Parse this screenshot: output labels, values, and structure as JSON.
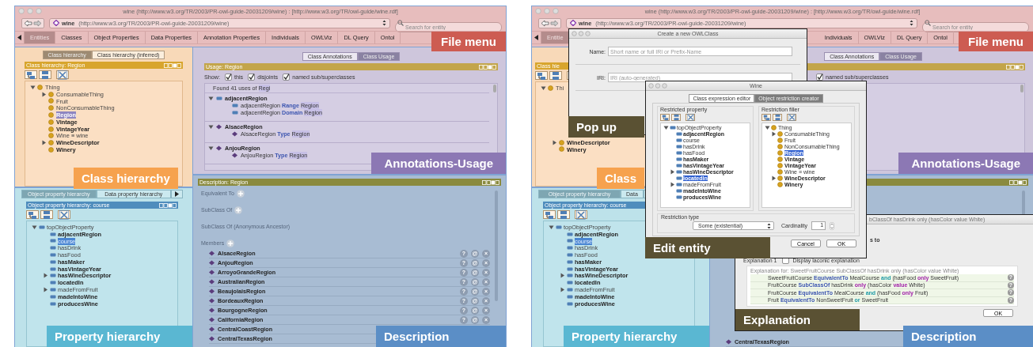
{
  "figures": [
    {
      "window": {
        "title": "wine (http://www.w3.org/TR/2003/PR-owl-guide-20031209/wine)  : [http://www.w3.org/TR/owl-guide/wine.rdf]"
      },
      "address": {
        "name": "wine",
        "iri": "(http://www.w3.org/TR/2003/PR-owl-guide-20031209/wine)"
      },
      "search": {
        "placeholder": "Search for entity"
      },
      "tabs": [
        {
          "label": "Entities",
          "selected": true
        },
        {
          "label": "Classes",
          "selected": false
        },
        {
          "label": "Object Properties",
          "selected": false
        },
        {
          "label": "Data Properties",
          "selected": false
        },
        {
          "label": "Annotation Properties",
          "selected": false
        },
        {
          "label": "Individuals",
          "selected": false
        },
        {
          "label": "OWLViz",
          "selected": false
        },
        {
          "label": "DL Query",
          "selected": false
        },
        {
          "label": "Ontol",
          "selected": false
        }
      ],
      "class_pane": {
        "tabs": [
          {
            "label": "Class hierarchy",
            "selected": true
          },
          {
            "label": "Class hierarchy (inferred)",
            "selected": false
          }
        ],
        "title": "Class hierarchy: Region",
        "tree": [
          {
            "label": "Thing",
            "kind": "class",
            "expanded": true,
            "bold": false,
            "selected": false,
            "children": [
              {
                "label": "ConsumableThing",
                "kind": "class",
                "expanded": false,
                "bold": false,
                "selected": false
              },
              {
                "label": "Fruit",
                "kind": "class",
                "bold": false,
                "selected": false
              },
              {
                "label": "NonConsumableThing",
                "kind": "class",
                "bold": false,
                "selected": false
              },
              {
                "label": "Region",
                "kind": "class",
                "bold": true,
                "selected": true
              },
              {
                "label": "Vintage",
                "kind": "class",
                "bold": true,
                "selected": false
              },
              {
                "label": "VintageYear",
                "kind": "class",
                "bold": true,
                "selected": false
              },
              {
                "label": "Wine ≡ wine",
                "kind": "class",
                "bold": false,
                "selected": false
              },
              {
                "label": "WineDescriptor",
                "kind": "class",
                "expanded": false,
                "bold": true,
                "selected": false
              },
              {
                "label": "Winery",
                "kind": "class",
                "bold": true,
                "selected": false
              }
            ]
          }
        ]
      },
      "usage_pane": {
        "tabs": [
          {
            "label": "Class Annotations",
            "selected": false
          },
          {
            "label": "Class Usage",
            "selected": true
          }
        ],
        "title": "Usage: Region",
        "show_label": "Show:",
        "options": [
          {
            "label": "this",
            "checked": true
          },
          {
            "label": "disjoints",
            "checked": true
          },
          {
            "label": "named sub/superclasses",
            "checked": true
          }
        ],
        "found": [
          {
            "text": "Found 41 uses of",
            "kind": "name"
          },
          {
            "text": "Regi",
            "kind": "match"
          }
        ],
        "groups": [
          {
            "kind": "property",
            "name": "adjacentRegion",
            "expanded": true,
            "axioms": [
              {
                "kind": "property",
                "tokens": [
                  {
                    "text": "adjacentRegion",
                    "kind": "name"
                  },
                  {
                    "text": "Range",
                    "kind": "keyword"
                  },
                  {
                    "text": "Region",
                    "kind": "match"
                  }
                ]
              },
              {
                "kind": "property",
                "tokens": [
                  {
                    "text": "adjacentRegion",
                    "kind": "name"
                  },
                  {
                    "text": "Domain",
                    "kind": "keyword"
                  },
                  {
                    "text": "Region",
                    "kind": "match"
                  }
                ]
              }
            ]
          },
          {
            "kind": "individual",
            "name": "AlsaceRegion",
            "expanded": true,
            "axioms": [
              {
                "kind": "individual",
                "tokens": [
                  {
                    "text": "AlsaceRegion",
                    "kind": "name"
                  },
                  {
                    "text": "Type",
                    "kind": "keyword"
                  },
                  {
                    "text": "Region",
                    "kind": "match"
                  }
                ]
              }
            ]
          },
          {
            "kind": "individual",
            "name": "AnjouRegion",
            "expanded": true,
            "axioms": [
              {
                "kind": "individual",
                "tokens": [
                  {
                    "text": "AnjouRegion",
                    "kind": "name"
                  },
                  {
                    "text": "Type",
                    "kind": "keyword"
                  },
                  {
                    "text": "Region",
                    "kind": "match"
                  }
                ]
              }
            ]
          }
        ]
      },
      "property_pane": {
        "tabs": [
          {
            "label": "Object property hierarchy",
            "selected": true
          },
          {
            "label": "Data property hierarchy",
            "selected": false
          }
        ],
        "title": "Object property hierarchy: course",
        "tree": [
          {
            "label": "topObjectProperty",
            "kind": "property",
            "expanded": true,
            "bold": false,
            "selected": false,
            "children": [
              {
                "label": "adjacentRegion",
                "kind": "property",
                "bold": true,
                "selected": false
              },
              {
                "label": "course",
                "kind": "property",
                "bold": false,
                "selected": true
              },
              {
                "label": "hasDrink",
                "kind": "property",
                "bold": false,
                "selected": false
              },
              {
                "label": "hasFood",
                "kind": "property",
                "bold": false,
                "selected": false
              },
              {
                "label": "hasMaker",
                "kind": "property",
                "bold": true,
                "selected": false
              },
              {
                "label": "hasVintageYear",
                "kind": "property",
                "bold": true,
                "selected": false
              },
              {
                "label": "hasWineDescriptor",
                "kind": "property",
                "expanded": false,
                "bold": true,
                "selected": false
              },
              {
                "label": "locatedIn",
                "kind": "property",
                "bold": true,
                "selected": false
              },
              {
                "label": "madeFromFruit",
                "kind": "property",
                "expanded": false,
                "bold": false,
                "selected": false
              },
              {
                "label": "madeIntoWine",
                "kind": "property",
                "bold": true,
                "selected": false
              },
              {
                "label": "producesWine",
                "kind": "property",
                "bold": true,
                "selected": false
              }
            ]
          }
        ]
      },
      "description_pane": {
        "title": "Description: Region",
        "sections": [
          {
            "label": "Equivalent To",
            "addable": true
          },
          {
            "label": "SubClass Of",
            "addable": true
          },
          {
            "label": "SubClass Of (Anonymous Ancestor)",
            "addable": false
          },
          {
            "label": "Members",
            "addable": true
          }
        ],
        "members": [
          {
            "name": "AlsaceRegion",
            "buttons": [
              "?",
              "@",
              "×"
            ]
          },
          {
            "name": "AnjouRegion",
            "buttons": [
              "?",
              "@",
              "×"
            ]
          },
          {
            "name": "ArroyoGrandeRegion",
            "buttons": [
              "?",
              "@",
              "×"
            ]
          },
          {
            "name": "AustralianRegion",
            "buttons": [
              "?",
              "@",
              "×"
            ]
          },
          {
            "name": "BeaujolaisRegion",
            "buttons": [
              "?",
              "@",
              "×"
            ]
          },
          {
            "name": "BordeauxRegion",
            "buttons": [
              "?",
              "@",
              "×"
            ]
          },
          {
            "name": "BourgogneRegion",
            "buttons": [
              "?",
              "@",
              "×"
            ]
          },
          {
            "name": "CaliforniaRegion",
            "buttons": [
              "?",
              "@",
              "×"
            ]
          },
          {
            "name": "CentralCoastRegion"
          },
          {
            "name": "CentralTexasRegion"
          }
        ]
      },
      "callouts": [
        {
          "kind": "tabs",
          "text": "File menu",
          "color": "#cd5c52"
        },
        {
          "kind": "class-pane",
          "text": "Class hierarchy",
          "color": "#f6a24e"
        },
        {
          "kind": "usage-pane",
          "text": "Annotations-Usage",
          "color": "#8c78b4"
        },
        {
          "kind": "property-pane",
          "text": "Property hierarchy",
          "color": "#5ab7d2"
        },
        {
          "kind": "description-pane",
          "text": "Description",
          "color": "#5b8ec6"
        }
      ]
    },
    {
      "window": {
        "title": "wine (http://www.w3.org/TR/2003/PR-owl-guide-20031209/wine)  : [http://www.w3.org/TR/owl-guide/wine.rdf]"
      },
      "address": {
        "name": "wine",
        "iri": "(http://www.w3.org/TR/2003/PR-owl-guide-20031209/wine)"
      },
      "search": {
        "placeholder": "Search for entity"
      },
      "tabs": [
        {
          "label": "Entitie",
          "selected": true
        },
        {
          "label": "Individuals",
          "selected": false
        },
        {
          "label": "OWLViz",
          "selected": false
        },
        {
          "label": "DL Query",
          "selected": false
        },
        {
          "label": "Ontol",
          "selected": false
        }
      ],
      "class_pane": {
        "title": "Class hie",
        "tree": [
          {
            "label": "Thi",
            "kind": "class",
            "expanded": true,
            "bold": false,
            "selected": false,
            "children": [
              {
                "label": "WineDescriptor",
                "kind": "class",
                "expanded": false,
                "bold": true,
                "selected": false
              },
              {
                "label": "Winery",
                "kind": "class",
                "bold": true,
                "selected": false
              }
            ]
          }
        ]
      },
      "usage_pane": {
        "tabs": [
          {
            "label": "Class Annotations",
            "selected": false
          },
          {
            "label": "Class Usage",
            "selected": true
          }
        ],
        "options": [
          {
            "label": "named sub/superclasses",
            "checked": true
          }
        ]
      },
      "property_pane": {
        "tabs": [
          {
            "label": "Object property hierarchy",
            "selected": true
          },
          {
            "label": "Data",
            "selected": false
          }
        ],
        "title": "Object property hierarchy: course",
        "tree": [
          {
            "label": "topObjectProperty",
            "kind": "property",
            "expanded": true,
            "bold": false,
            "selected": false,
            "children": [
              {
                "label": "adjacentRegion",
                "kind": "property",
                "bold": true,
                "selected": false
              },
              {
                "label": "course",
                "kind": "property",
                "bold": false,
                "selected": true
              },
              {
                "label": "hasDrink",
                "kind": "property",
                "bold": false,
                "selected": false
              },
              {
                "label": "hasFood",
                "kind": "property",
                "bold": false,
                "selected": false
              },
              {
                "label": "hasMaker",
                "kind": "property",
                "bold": true,
                "selected": false
              },
              {
                "label": "hasVintageYear",
                "kind": "property",
                "bold": true,
                "selected": false
              },
              {
                "label": "hasWineDescriptor",
                "kind": "property",
                "expanded": false,
                "bold": true,
                "selected": false
              },
              {
                "label": "locatedIn",
                "kind": "property",
                "bold": true,
                "selected": false
              },
              {
                "label": "madeFromFruit",
                "kind": "property",
                "expanded": false,
                "bold": false,
                "selected": false
              },
              {
                "label": "madeIntoWine",
                "kind": "property",
                "bold": true,
                "selected": false
              },
              {
                "label": "producesWine",
                "kind": "property",
                "bold": true,
                "selected": false
              }
            ]
          }
        ]
      },
      "description_pane": {
        "members": [
          {
            "name": "CentralTexasRegion"
          }
        ]
      },
      "dialogs": [
        {
          "kind": "create-class",
          "title": "Create a new OWLClass",
          "fields": [
            {
              "label": "Name:",
              "placeholder": "Short name or full IRI or Prefix-Name"
            },
            {
              "label": "IRI:",
              "placeholder": "IRI (auto-generated)"
            }
          ]
        },
        {
          "kind": "explanation",
          "title": "bClassOf hasDrink only (hasColor value White)",
          "partial": "s to",
          "explanation_label": "Explanation 1",
          "laconic": {
            "label": "Display laconic explanation",
            "checked": false
          },
          "heading": "Explanation for: SweetFruitCourse SubClassOf hasDrink only (hasColor value White)",
          "axioms": [
            {
              "help": "?",
              "tokens": [
                {
                  "text": "SweetFruitCourse",
                  "kind": "name"
                },
                {
                  "text": "EquivalentTo",
                  "kind": "keyword"
                },
                {
                  "text": "MealCourse",
                  "kind": "name"
                },
                {
                  "text": "and",
                  "kind": "connective"
                },
                {
                  "text": "(hasFood",
                  "kind": "name"
                },
                {
                  "text": "only",
                  "kind": "restriction"
                },
                {
                  "text": "SweetFruit)",
                  "kind": "name"
                }
              ]
            },
            {
              "help": "?",
              "tokens": [
                {
                  "text": "FruitCourse",
                  "kind": "name"
                },
                {
                  "text": "SubClassOf",
                  "kind": "keyword"
                },
                {
                  "text": "hasDrink",
                  "kind": "name"
                },
                {
                  "text": "only",
                  "kind": "restriction"
                },
                {
                  "text": "(hasColor",
                  "kind": "name"
                },
                {
                  "text": "value",
                  "kind": "restriction"
                },
                {
                  "text": "White)",
                  "kind": "name"
                }
              ]
            },
            {
              "help": "?",
              "tokens": [
                {
                  "text": "FruitCourse",
                  "kind": "name"
                },
                {
                  "text": "EquivalentTo",
                  "kind": "keyword"
                },
                {
                  "text": "MealCourse",
                  "kind": "name"
                },
                {
                  "text": "and",
                  "kind": "connective"
                },
                {
                  "text": "(hasFood",
                  "kind": "name"
                },
                {
                  "text": "only",
                  "kind": "restriction"
                },
                {
                  "text": "Fruit)",
                  "kind": "name"
                }
              ]
            },
            {
              "help": "?",
              "tokens": [
                {
                  "text": "Fruit",
                  "kind": "name"
                },
                {
                  "text": "EquivalentTo",
                  "kind": "keyword"
                },
                {
                  "text": "NonSweetFruit",
                  "kind": "name"
                },
                {
                  "text": "or",
                  "kind": "connective"
                },
                {
                  "text": "SweetFruit",
                  "kind": "name"
                }
              ]
            }
          ],
          "buttons": [
            "OK"
          ]
        },
        {
          "kind": "restriction",
          "title": "Wine",
          "tabs": [
            {
              "label": "Class expression editor",
              "selected": false
            },
            {
              "label": "Object restriction creator",
              "selected": true
            }
          ],
          "groups": [
            {
              "label": "Restricted property",
              "tree": [
                {
                  "label": "topObjectProperty",
                  "kind": "property",
                  "expanded": true,
                  "bold": false,
                  "selected": false,
                  "children": [
                    {
                      "label": "adjacentRegion",
                      "kind": "property",
                      "bold": true,
                      "selected": false
                    },
                    {
                      "label": "course",
                      "kind": "property",
                      "bold": false,
                      "selected": false
                    },
                    {
                      "label": "hasDrink",
                      "kind": "property",
                      "bold": false,
                      "selected": false
                    },
                    {
                      "label": "hasFood",
                      "kind": "property",
                      "bold": false,
                      "selected": false
                    },
                    {
                      "label": "hasMaker",
                      "kind": "property",
                      "bold": true,
                      "selected": false
                    },
                    {
                      "label": "hasVintageYear",
                      "kind": "property",
                      "bold": true,
                      "selected": false
                    },
                    {
                      "label": "hasWineDescriptor",
                      "kind": "property",
                      "expanded": false,
                      "bold": true,
                      "selected": false
                    },
                    {
                      "label": "locatedIn",
                      "kind": "property",
                      "bold": true,
                      "selected": true
                    },
                    {
                      "label": "madeFromFruit",
                      "kind": "property",
                      "expanded": false,
                      "bold": false,
                      "selected": false
                    },
                    {
                      "label": "madeIntoWine",
                      "kind": "property",
                      "bold": true,
                      "selected": false
                    },
                    {
                      "label": "producesWine",
                      "kind": "property",
                      "bold": true,
                      "selected": false
                    }
                  ]
                }
              ]
            },
            {
              "label": "Restriction filler",
              "tree": [
                {
                  "label": "Thing",
                  "kind": "class",
                  "expanded": true,
                  "bold": false,
                  "selected": false,
                  "children": [
                    {
                      "label": "ConsumableThing",
                      "kind": "class",
                      "expanded": false,
                      "bold": false,
                      "selected": false
                    },
                    {
                      "label": "Fruit",
                      "kind": "class",
                      "bold": false,
                      "selected": false
                    },
                    {
                      "label": "NonConsumableThing",
                      "kind": "class",
                      "bold": false,
                      "selected": false
                    },
                    {
                      "label": "Region",
                      "kind": "class",
                      "bold": true,
                      "selected": true
                    },
                    {
                      "label": "Vintage",
                      "kind": "class",
                      "bold": true,
                      "selected": false
                    },
                    {
                      "label": "VintageYear",
                      "kind": "class",
                      "bold": true,
                      "selected": false
                    },
                    {
                      "label": "Wine ≡ wine",
                      "kind": "class",
                      "bold": false,
                      "selected": false
                    },
                    {
                      "label": "WineDescriptor",
                      "kind": "class",
                      "expanded": false,
                      "bold": true,
                      "selected": false
                    },
                    {
                      "label": "Winery",
                      "kind": "class",
                      "bold": true,
                      "selected": false
                    }
                  ]
                }
              ]
            }
          ],
          "type_label": "Restriction type",
          "type_value": "Some (existential)",
          "cardinality_label": "Cardinality",
          "cardinality": "1",
          "buttons": [
            "Cancel",
            "OK"
          ]
        }
      ],
      "callouts": [
        {
          "kind": "tabs",
          "text": "File menu",
          "color": "#cd5c52"
        },
        {
          "kind": "class-pane",
          "text": "Class",
          "color": "#f6a24e"
        },
        {
          "kind": "usage-pane",
          "text": "Annotations-Usage",
          "color": "#8c78b4"
        },
        {
          "kind": "property-pane",
          "text": "Property hierarchy",
          "color": "#5ab7d2"
        },
        {
          "kind": "description-pane",
          "text": "Description",
          "color": "#5b8ec6"
        },
        {
          "kind": "create-class",
          "text": "Pop up",
          "color": "#5a5133"
        },
        {
          "kind": "restriction",
          "text": "Edit entity",
          "color": "#5a5133"
        },
        {
          "kind": "explanation",
          "text": "Explanation",
          "color": "#5a5133"
        }
      ]
    }
  ]
}
